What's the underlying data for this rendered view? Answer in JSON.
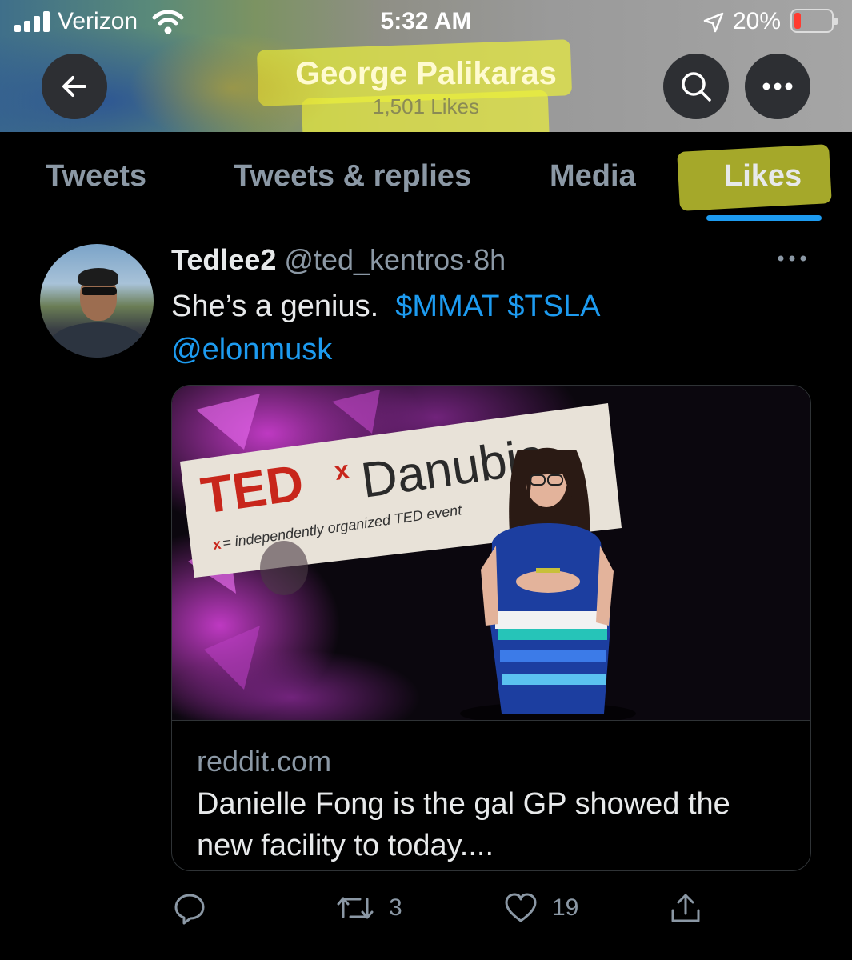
{
  "status_bar": {
    "carrier": "Verizon",
    "time": "5:32 AM",
    "battery_percent": "20%",
    "battery_level": 0.2,
    "icons": [
      "signal-icon",
      "wifi-icon",
      "location-arrow-icon",
      "battery-icon"
    ]
  },
  "header": {
    "name": "George Palikaras",
    "likes_count": "1,501 Likes",
    "buttons": [
      "back-arrow-icon",
      "search-icon",
      "more-dots-icon"
    ]
  },
  "tabs": [
    {
      "label": "Tweets",
      "active": false
    },
    {
      "label": "Tweets & replies",
      "active": false
    },
    {
      "label": "Media",
      "active": false
    },
    {
      "label": "Likes",
      "active": true
    }
  ],
  "colors": {
    "accent": "#1d9bf0",
    "background": "#000000",
    "secondary_text": "#8b98a5",
    "highlight_marker": "#ebf03c"
  },
  "tweet": {
    "display_name": "Tedlee2",
    "handle": "@ted_kentros",
    "separator": "·",
    "time_ago": "8h",
    "text_plain": "She’s a genius.",
    "cashtags": "$MMAT $TSLA",
    "mention": "@elonmusk",
    "card": {
      "image_text": {
        "brand": "TED",
        "superscript": "x",
        "event": "Danubia",
        "tagline_prefix": "x",
        "tagline": "= independently organized TED event"
      },
      "domain": "reddit.com",
      "title": "Danielle Fong is the gal GP showed the new facility to today...."
    },
    "actions": {
      "reply_count": "",
      "retweet_count": "3",
      "like_count": "19"
    }
  }
}
